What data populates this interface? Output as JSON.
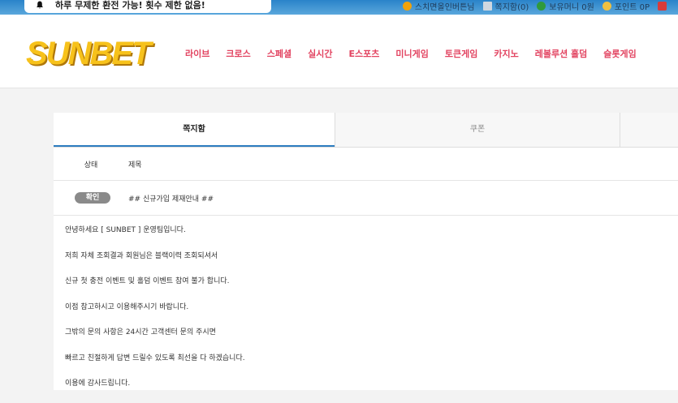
{
  "notice": {
    "text": "하루 무제한 환전 가능! 횟수 제한 없음!"
  },
  "user": [
    {
      "label": "스치면올인버튼님",
      "color": "#f2a20a"
    },
    {
      "label": "쪽지함(0)",
      "color": "#cfd7e0"
    },
    {
      "label": "보유머니 0원",
      "color": "#2f9a3c"
    },
    {
      "label": "포인트 0P",
      "color": "#f0c040"
    },
    {
      "label": "",
      "color": "#d83b3b"
    }
  ],
  "logo": "SUNBET",
  "nav": [
    "라이브",
    "크로스",
    "스페셜",
    "실시간",
    "E스포츠",
    "미니게임",
    "토큰게임",
    "카지노",
    "레볼루션 홀덤",
    "슬롯게임"
  ],
  "tabs": {
    "inbox": "쪽지함",
    "coupon": "쿠폰"
  },
  "table": {
    "status": "상태",
    "subject": "제목"
  },
  "message": {
    "status": "확인",
    "title": "## 신규가입 제재안내 ##",
    "lines": [
      "안녕하세요 [ SUNBET ] 운영팀입니다.",
      "저희 자체 조회결과 회원님은 블랙이력 조회되셔서",
      "신규 첫 충전 이벤트 및 홀덤 이벤트 참여 불가 합니다.",
      "이점 참고하시고 이용해주시기 바랍니다.",
      "그밖의 문의 사항은 24시간 고객센터 문의 주시면",
      "빠르고 친절하게 답변 드릴수 있도록 최선을 다 하겠습니다.",
      "이용에 감사드립니다."
    ]
  }
}
